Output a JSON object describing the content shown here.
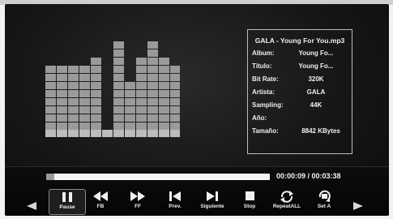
{
  "track_info": {
    "title": "GALA - Young For You.mp3",
    "rows": [
      {
        "label": "Album:",
        "value": "Young Fo..."
      },
      {
        "label": "Título:",
        "value": "Young Fo..."
      },
      {
        "label": "Bit Rate:",
        "value": "320K"
      },
      {
        "label": "Artista:",
        "value": "GALA"
      },
      {
        "label": "Sampling:",
        "value": "44K"
      },
      {
        "label": "Año:",
        "value": ""
      },
      {
        "label": "Tamaño:",
        "value": "8842 KBytes"
      }
    ]
  },
  "playback": {
    "progress_fraction": 0.035,
    "time_display": "00:00:09 / 00:03:38"
  },
  "spectrum": {
    "max_cells": 12,
    "bars": [
      8,
      8,
      8,
      8,
      9,
      0,
      11,
      6,
      9,
      11,
      9,
      8
    ]
  },
  "controls": {
    "buttons": [
      {
        "id": "pause",
        "label": "Pause",
        "icon": "pause-icon"
      },
      {
        "id": "fb",
        "label": "FB",
        "icon": "fast-backward-icon"
      },
      {
        "id": "ff",
        "label": "FF",
        "icon": "fast-forward-icon"
      },
      {
        "id": "prev",
        "label": "Prev.",
        "icon": "previous-track-icon"
      },
      {
        "id": "next",
        "label": "Siguiente",
        "icon": "next-track-icon"
      },
      {
        "id": "stop",
        "label": "Stop",
        "icon": "stop-icon"
      },
      {
        "id": "repeat",
        "label": "RepeatALL",
        "icon": "repeat-icon"
      },
      {
        "id": "seta",
        "label": "Set A",
        "icon": "set-a-icon"
      }
    ],
    "active": "pause"
  },
  "colors": {
    "spectrum_cell": "#9a9a9a",
    "spectrum_base": "#bdbdbd",
    "info_border": "#bdbdbd",
    "progress_track": "#f4f4f4",
    "progress_fill": "#9a9a9a"
  }
}
